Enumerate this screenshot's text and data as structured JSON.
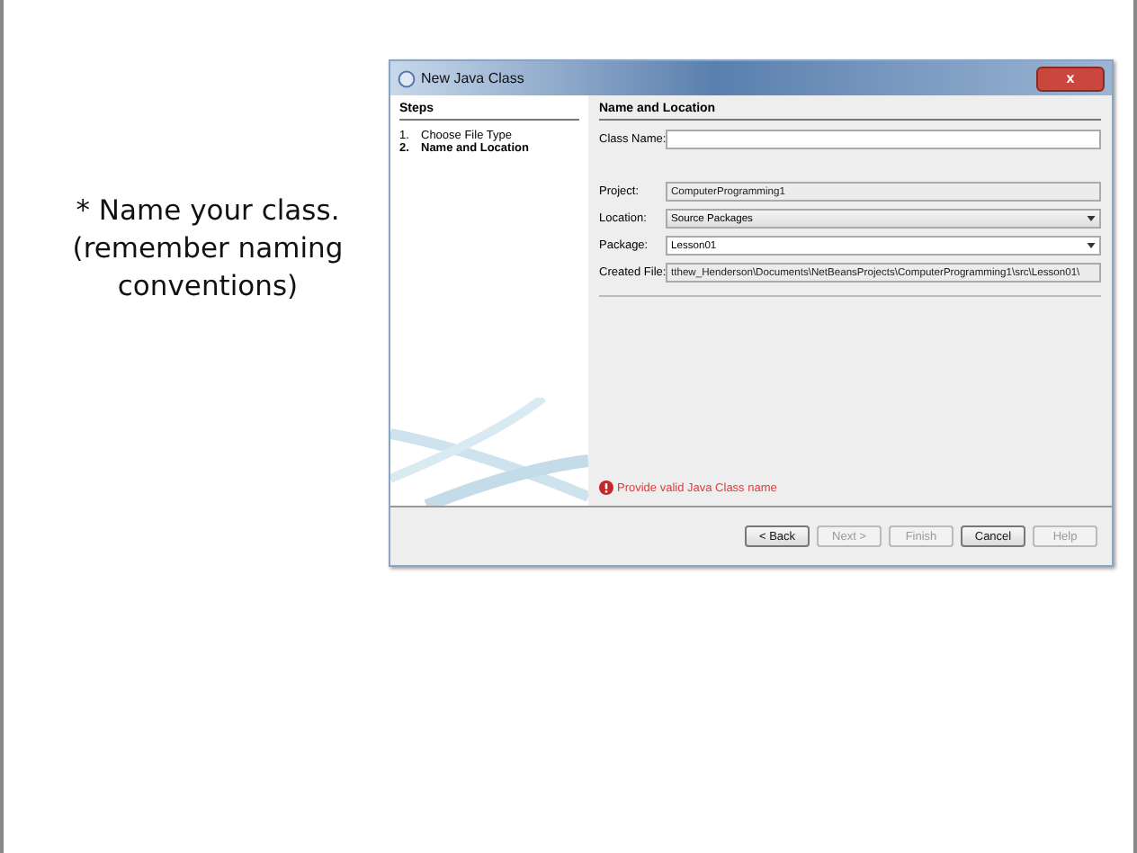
{
  "slide": {
    "note_lines": [
      "* Name your class.",
      "(remember naming",
      "conventions)"
    ]
  },
  "dialog": {
    "title": "New Java Class",
    "close": "x",
    "steps": {
      "heading": "Steps",
      "items": [
        {
          "number": "1.",
          "label": "Choose File Type",
          "selected": false
        },
        {
          "number": "2.",
          "label": "Name and Location",
          "selected": true
        }
      ]
    },
    "panel_heading": "Name and Location",
    "fields": [
      {
        "kind": "input",
        "label": "Class Name:"
      },
      {
        "kind": "readonly",
        "label": "Project:",
        "value": "ComputerProgramming1"
      },
      {
        "kind": "combo",
        "label": "Location:",
        "value": "Source Packages",
        "filled": true
      },
      {
        "kind": "combo",
        "label": "Package:",
        "value": "Lesson01",
        "filled": false
      },
      {
        "kind": "readonly",
        "label": "Created File:",
        "value": "tthew_Henderson\\Documents\\NetBeansProjects\\ComputerProgramming1\\src\\Lesson01\\"
      }
    ],
    "error": "Provide valid Java Class name",
    "buttons": [
      {
        "label": "< Back",
        "disabled": false
      },
      {
        "label": "Next >",
        "disabled": true
      },
      {
        "label": "Finish",
        "disabled": true
      },
      {
        "label": "Cancel",
        "disabled": false
      },
      {
        "label": "Help",
        "disabled": true
      }
    ]
  }
}
